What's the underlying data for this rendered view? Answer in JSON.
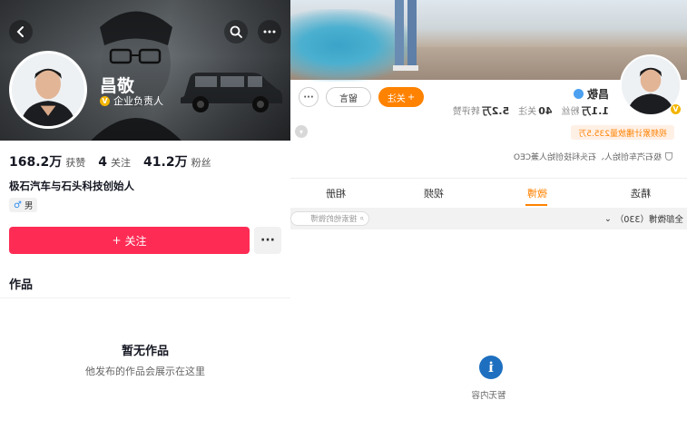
{
  "left": {
    "name": "昌敬",
    "cert_label": "企业负责人",
    "stats": [
      {
        "num": "168.2万",
        "label": "获赞"
      },
      {
        "num": "4",
        "label": "关注"
      },
      {
        "num": "41.2万",
        "label": "粉丝"
      }
    ],
    "bio": "极石汽车与石头科技创始人",
    "gender_label": "男",
    "follow_label": "关注",
    "works_title": "作品",
    "empty_title": "暂无作品",
    "empty_sub": "他发布的作品会展示在这里"
  },
  "right": {
    "name": "昌敬",
    "stats": [
      {
        "num": "5.2万",
        "label": "转评赞"
      },
      {
        "num": "40",
        "label": "关注"
      },
      {
        "num": "1.1万",
        "label": "粉丝"
      }
    ],
    "follow_label": "关注",
    "message_label": "留言",
    "views_text": "视频累计播放量235.5万",
    "bio": "极石汽车创始人、石头科技创始人兼CEO",
    "tabs": [
      "精选",
      "微博",
      "视频",
      "相册"
    ],
    "filter_label": "全部微博（330）",
    "search_placeholder": "搜索他的微博",
    "empty_text": "暂无内容"
  },
  "colors": {
    "douyin_follow": "#fe2c55",
    "weibo_accent": "#ff8200",
    "verified_badge": "#f3b500"
  }
}
